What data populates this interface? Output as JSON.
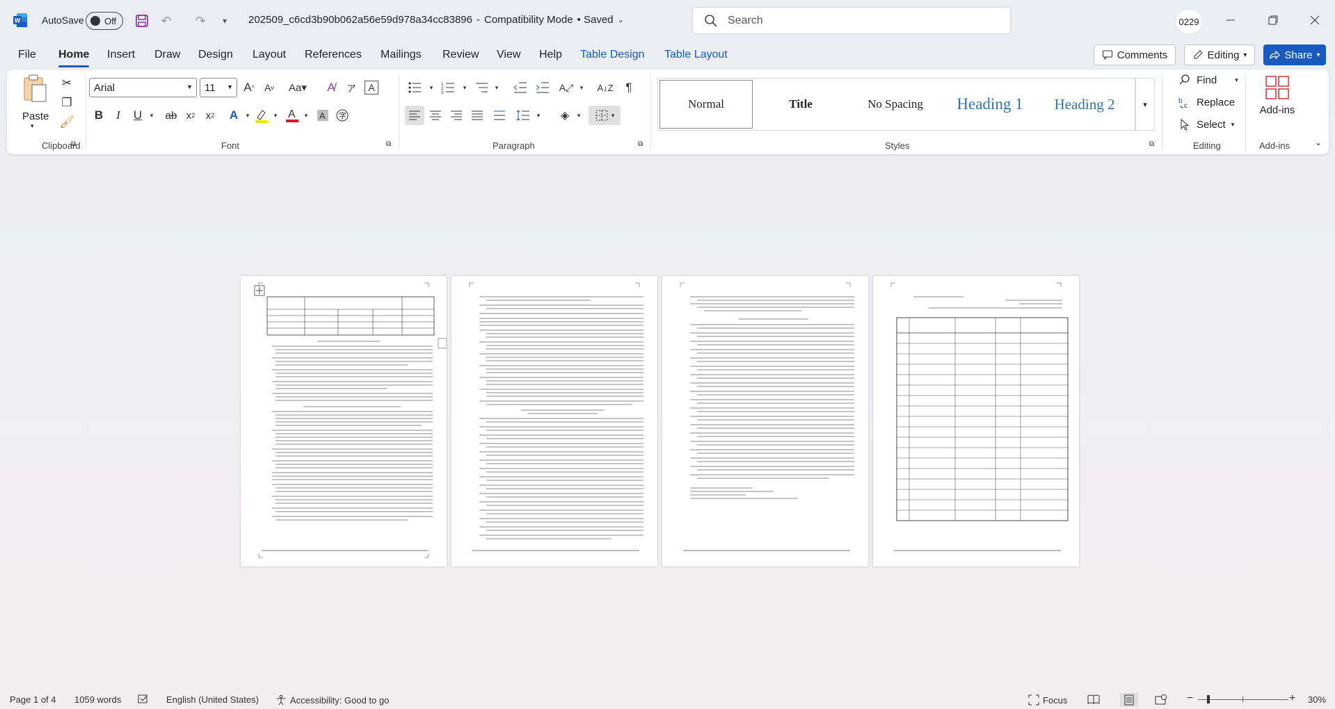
{
  "titlebar": {
    "autosave_label": "AutoSave",
    "autosave_state": "Off",
    "doc_name": "202509_c6cd3b90b062a56e59d978a34cc83896",
    "separator": "-",
    "mode": "Compatibility Mode",
    "status": "• Saved",
    "search_placeholder": "Search",
    "user_initials": "0229"
  },
  "tabs": [
    "File",
    "Home",
    "Insert",
    "Draw",
    "Design",
    "Layout",
    "References",
    "Mailings",
    "Review",
    "View",
    "Help",
    "Table Design",
    "Table Layout"
  ],
  "actions": {
    "comments": "Comments",
    "editing": "Editing",
    "share": "Share"
  },
  "ribbon": {
    "clipboard": {
      "paste": "Paste",
      "label": "Clipboard"
    },
    "font": {
      "name": "Arial",
      "size": "11",
      "label": "Font"
    },
    "paragraph": {
      "label": "Paragraph"
    },
    "styles": {
      "label": "Styles",
      "items": [
        "Normal",
        "Title",
        "No Spacing",
        "Heading 1",
        "Heading 2"
      ]
    },
    "editing": {
      "find": "Find",
      "replace": "Replace",
      "select": "Select",
      "label": "Editing"
    },
    "addins": {
      "button": "Add-ins",
      "label": "Add-ins"
    }
  },
  "statusbar": {
    "page": "Page 1 of 4",
    "words": "1059 words",
    "language": "English (United States)",
    "accessibility": "Accessibility: Good to go",
    "focus": "Focus",
    "zoom": "30%"
  },
  "colors": {
    "accent": "#185abd",
    "word_blue": "#185abd",
    "font_color_red": "#e81123",
    "highlight_yellow": "#ffe600"
  }
}
